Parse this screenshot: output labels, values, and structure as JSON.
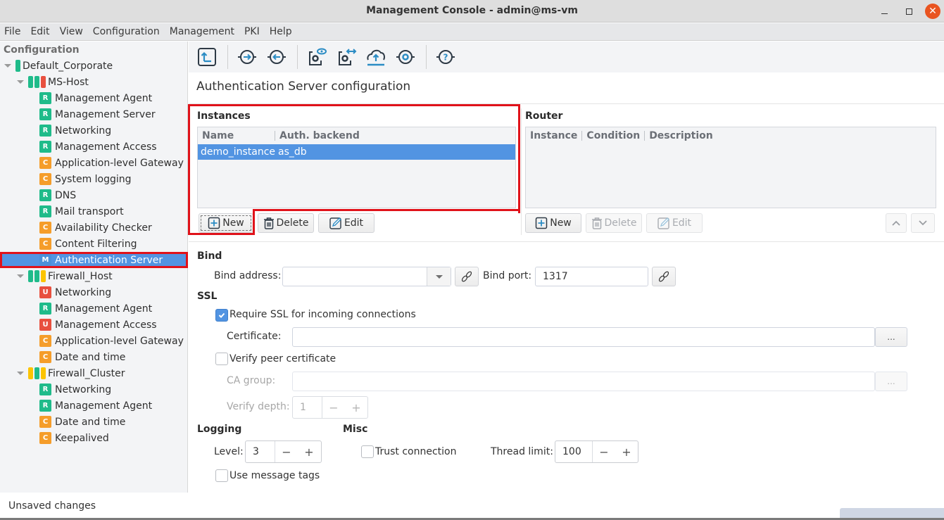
{
  "window": {
    "title": "Management Console - admin@ms-vm",
    "minimize_label": "",
    "close_glyph": "✕"
  },
  "menu": [
    "File",
    "Edit",
    "View",
    "Configuration",
    "Management",
    "PKI",
    "Help"
  ],
  "sidebar": {
    "title": "Configuration",
    "tree": [
      {
        "label": "Default_Corporate",
        "level": 0,
        "expandable": true,
        "bars": [
          "green"
        ]
      },
      {
        "label": "MS-Host",
        "level": 1,
        "expandable": true,
        "bars": [
          "green",
          "green",
          "red"
        ]
      },
      {
        "label": "Management Agent",
        "level": 2,
        "badge": "R"
      },
      {
        "label": "Management Server",
        "level": 2,
        "badge": "R"
      },
      {
        "label": "Networking",
        "level": 2,
        "badge": "R"
      },
      {
        "label": "Management Access",
        "level": 2,
        "badge": "R"
      },
      {
        "label": "Application-level Gateway",
        "level": 2,
        "badge": "C"
      },
      {
        "label": "System logging",
        "level": 2,
        "badge": "C"
      },
      {
        "label": "DNS",
        "level": 2,
        "badge": "R"
      },
      {
        "label": "Mail transport",
        "level": 2,
        "badge": "R"
      },
      {
        "label": "Availability Checker",
        "level": 2,
        "badge": "C"
      },
      {
        "label": "Content Filtering",
        "level": 2,
        "badge": "C"
      },
      {
        "label": "Authentication Server",
        "level": 2,
        "badge": "M",
        "selected": true
      },
      {
        "label": "Firewall_Host",
        "level": 1,
        "expandable": true,
        "bars": [
          "green",
          "green",
          "yellow"
        ]
      },
      {
        "label": "Networking",
        "level": 2,
        "badge": "U"
      },
      {
        "label": "Management Agent",
        "level": 2,
        "badge": "R"
      },
      {
        "label": "Management Access",
        "level": 2,
        "badge": "U"
      },
      {
        "label": "Application-level Gateway",
        "level": 2,
        "badge": "C"
      },
      {
        "label": "Date and time",
        "level": 2,
        "badge": "C"
      },
      {
        "label": "Firewall_Cluster",
        "level": 1,
        "expandable": true,
        "bars": [
          "yellow",
          "green",
          "yellow"
        ]
      },
      {
        "label": "Networking",
        "level": 2,
        "badge": "R"
      },
      {
        "label": "Management Agent",
        "level": 2,
        "badge": "R"
      },
      {
        "label": "Date and time",
        "level": 2,
        "badge": "C"
      },
      {
        "label": "Keepalived",
        "level": 2,
        "badge": "C"
      }
    ]
  },
  "toolbar": {
    "buttons": [
      {
        "name": "upload-config-icon"
      },
      {
        "name": "connect-in-icon"
      },
      {
        "name": "connect-out-icon"
      },
      {
        "name": "view-config-icon"
      },
      {
        "name": "compare-config-icon"
      },
      {
        "name": "cloud-upload-icon"
      },
      {
        "name": "settings-node-icon"
      },
      {
        "name": "help-icon"
      }
    ]
  },
  "page": {
    "title": "Authentication Server configuration",
    "instances": {
      "label": "Instances",
      "columns": [
        "Name",
        "Auth. backend"
      ],
      "rows": [
        [
          "demo_instance",
          "as_db"
        ]
      ],
      "buttons": {
        "new": "New",
        "delete": "Delete",
        "edit": "Edit"
      }
    },
    "router": {
      "label": "Router",
      "columns": [
        "Instance",
        "Condition",
        "Description"
      ],
      "rows": [],
      "buttons": {
        "new": "New",
        "delete": "Delete",
        "edit": "Edit"
      }
    },
    "bind": {
      "label": "Bind",
      "address_label": "Bind address:",
      "address_value": "",
      "port_label": "Bind port:",
      "port_value": "1317"
    },
    "ssl": {
      "label": "SSL",
      "require_ssl_label": "Require SSL for incoming connections",
      "require_ssl_checked": true,
      "certificate_label": "Certificate:",
      "certificate_value": "",
      "browse_label": "...",
      "verify_peer_label": "Verify peer certificate",
      "verify_peer_checked": false,
      "ca_group_label": "CA group:",
      "ca_group_value": "",
      "verify_depth_label": "Verify depth:",
      "verify_depth_value": "1"
    },
    "logging": {
      "label": "Logging",
      "level_label": "Level:",
      "level_value": "3",
      "use_tags_label": "Use message tags",
      "use_tags_checked": false
    },
    "misc": {
      "label": "Misc",
      "trust_label": "Trust connection",
      "trust_checked": false,
      "thread_limit_label": "Thread limit:",
      "thread_limit_value": "100"
    },
    "spin_minus": "−",
    "spin_plus": "+"
  },
  "status": {
    "text": "Unsaved changes"
  },
  "colors": {
    "accent": "#5294e2",
    "highlight_box": "#e0121a",
    "badge_R": "#1fbb8a",
    "badge_C": "#f59d2a",
    "badge_U": "#e8503f",
    "close_button": "#e95420"
  }
}
